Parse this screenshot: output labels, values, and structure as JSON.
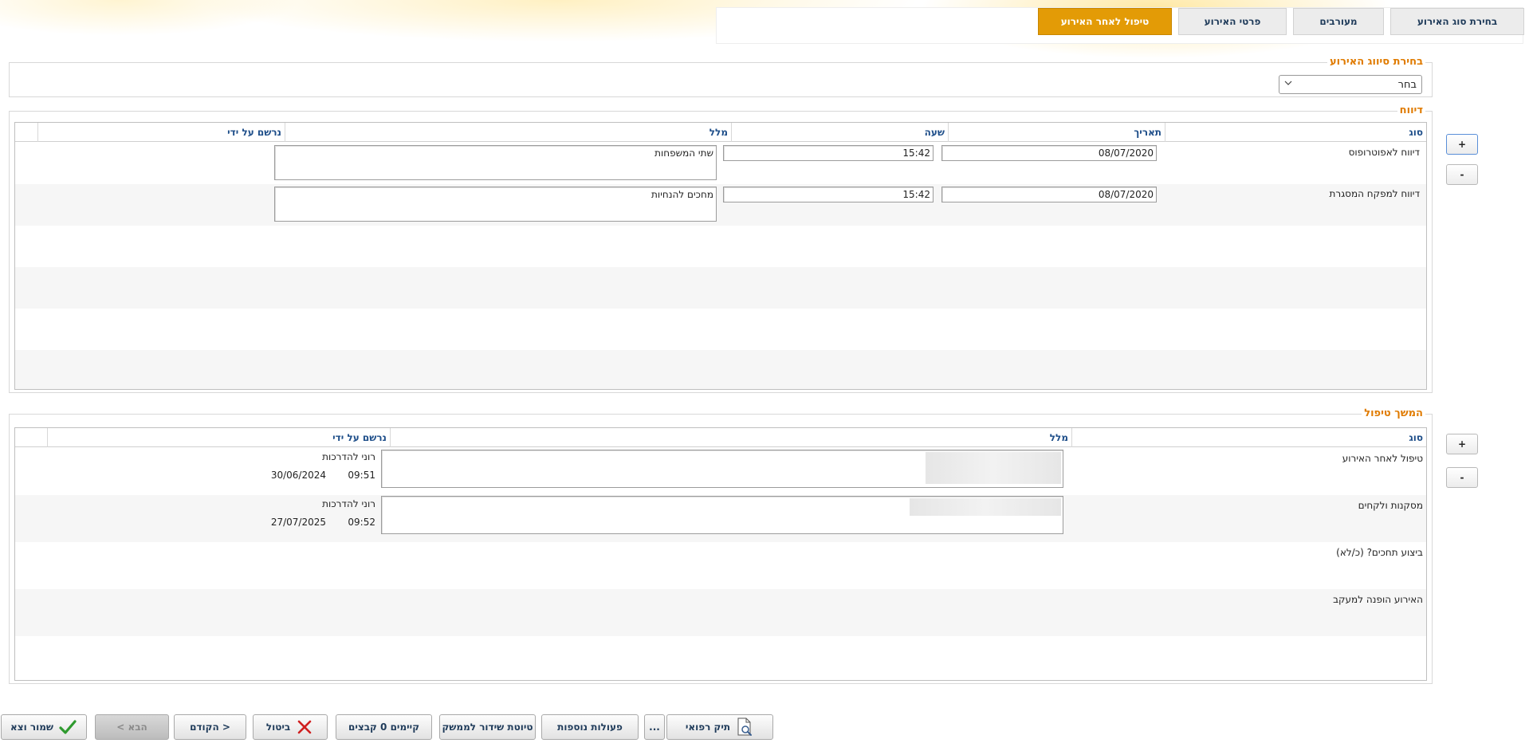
{
  "tabs": [
    {
      "label": "בחירת סוג האירוע"
    },
    {
      "label": "מעורבים"
    },
    {
      "label": "פרטי האירוע"
    },
    {
      "label": "טיפול לאחר האירוע",
      "active": true
    }
  ],
  "classification": {
    "legend": "בחירת סיווג האירוע",
    "select_value": "בחר"
  },
  "reporting": {
    "legend": "דיווח",
    "columns": [
      "סוג",
      "תאריך",
      "שעה",
      "מלל",
      "נרשם על ידי"
    ],
    "rows": [
      {
        "type": "דיווח לאפוטרופוס",
        "date": "08/07/2020",
        "time": "15:42",
        "text": "שתי המשפחות"
      },
      {
        "type": "דיווח למפקח המסגרת",
        "date": "08/07/2020",
        "time": "15:42",
        "text": "מחכים להנחיות"
      }
    ],
    "add_label": "+",
    "remove_label": "-"
  },
  "followup": {
    "legend": "המשך טיפול",
    "columns": [
      "סוג",
      "מלל",
      "נרשם על ידי"
    ],
    "rows": [
      {
        "type": "טיפול לאחר האירוע",
        "recorded_by": "רוני להדרכות",
        "time": "09:51",
        "date": "30/06/2024"
      },
      {
        "type": "מסקנות ולקחים",
        "recorded_by": "רוני להדרכות",
        "time": "09:52",
        "date": "27/07/2025"
      },
      {
        "type": "ביצוע תחכים? (כ/לא)"
      },
      {
        "type": "האירוע הופנה למעקב"
      }
    ],
    "add_label": "+",
    "remove_label": "-"
  },
  "toolbar": {
    "save_exit": "שמור וצא",
    "next": "הבא >",
    "prev": "< הקודם",
    "cancel": "ביטול",
    "files": "קיימים 0 קבצים",
    "draft": "טיוטת שידור לממשק",
    "more_actions": "פעולות נוספות",
    "ellipsis": "...",
    "medical_file": "תיק רפואי"
  },
  "colors": {
    "accent": "#e39b06",
    "legend": "#e07b00",
    "header_text": "#1f4f8a"
  }
}
